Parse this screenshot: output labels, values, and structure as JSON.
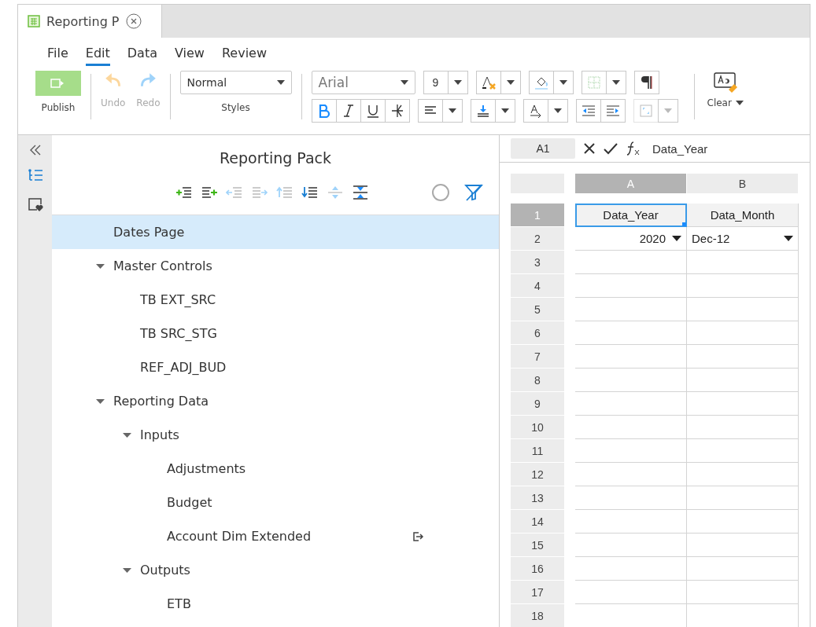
{
  "tab": {
    "title": "Reporting P"
  },
  "menu": [
    {
      "label": "File",
      "selected": false
    },
    {
      "label": "Edit",
      "selected": true
    },
    {
      "label": "Data",
      "selected": false
    },
    {
      "label": "View",
      "selected": false
    },
    {
      "label": "Review",
      "selected": false
    }
  ],
  "toolbar": {
    "publish": {
      "label": "Publish"
    },
    "undo": {
      "label": "Undo",
      "disabled": true
    },
    "redo": {
      "label": "Redo",
      "disabled": true
    },
    "style": {
      "value": "Normal",
      "label": "Styles"
    },
    "font": {
      "value": "Arial"
    },
    "size": {
      "value": "9"
    },
    "bold": {
      "selected": true
    },
    "clear": {
      "label": "Clear"
    }
  },
  "tree": {
    "title": "Reporting Pack",
    "items": [
      {
        "label": "Dates Page",
        "selected": true
      },
      {
        "label": "Master Controls",
        "selected": false,
        "expanded": true,
        "children": [
          {
            "label": "TB EXT_SRC",
            "selected": false
          },
          {
            "label": "TB SRC_STG",
            "selected": false
          },
          {
            "label": "REF_ADJ_BUD",
            "selected": false
          }
        ]
      },
      {
        "label": "Reporting Data",
        "selected": false,
        "expanded": true,
        "children": [
          {
            "label": "Inputs",
            "selected": false,
            "expanded": true,
            "children": [
              {
                "label": "Adjustments",
                "selected": false
              },
              {
                "label": "Budget",
                "selected": false
              },
              {
                "label": "Account Dim Extended",
                "selected": false,
                "linked": true
              }
            ]
          },
          {
            "label": "Outputs",
            "selected": false,
            "expanded": true,
            "children": [
              {
                "label": "ETB",
                "selected": false
              }
            ]
          }
        ]
      }
    ]
  },
  "sheet": {
    "name_box": "A1",
    "formula": "Data_Year",
    "columns": [
      {
        "label": "A",
        "selected": true
      },
      {
        "label": "B",
        "selected": false
      }
    ],
    "rows": [
      {
        "label": "1",
        "selected": true,
        "cells": [
          {
            "value": "Data_Year",
            "kind": "header",
            "active": true
          },
          {
            "value": "Data_Month",
            "kind": "header",
            "active": false
          }
        ]
      },
      {
        "label": "2",
        "selected": false,
        "cells": [
          {
            "value": "2020",
            "kind": "number-dropdown",
            "active": false
          },
          {
            "value": "Dec-12",
            "kind": "text-dropdown",
            "active": false
          }
        ]
      },
      {
        "label": "3",
        "selected": false
      },
      {
        "label": "4",
        "selected": false
      },
      {
        "label": "5",
        "selected": false
      },
      {
        "label": "6",
        "selected": false
      },
      {
        "label": "7",
        "selected": false
      },
      {
        "label": "8",
        "selected": false
      },
      {
        "label": "9",
        "selected": false
      },
      {
        "label": "10",
        "selected": false
      },
      {
        "label": "11",
        "selected": false
      },
      {
        "label": "12",
        "selected": false
      },
      {
        "label": "13",
        "selected": false
      },
      {
        "label": "14",
        "selected": false
      },
      {
        "label": "15",
        "selected": false
      },
      {
        "label": "16",
        "selected": false
      },
      {
        "label": "17",
        "selected": false
      },
      {
        "label": "18",
        "selected": false
      }
    ]
  }
}
